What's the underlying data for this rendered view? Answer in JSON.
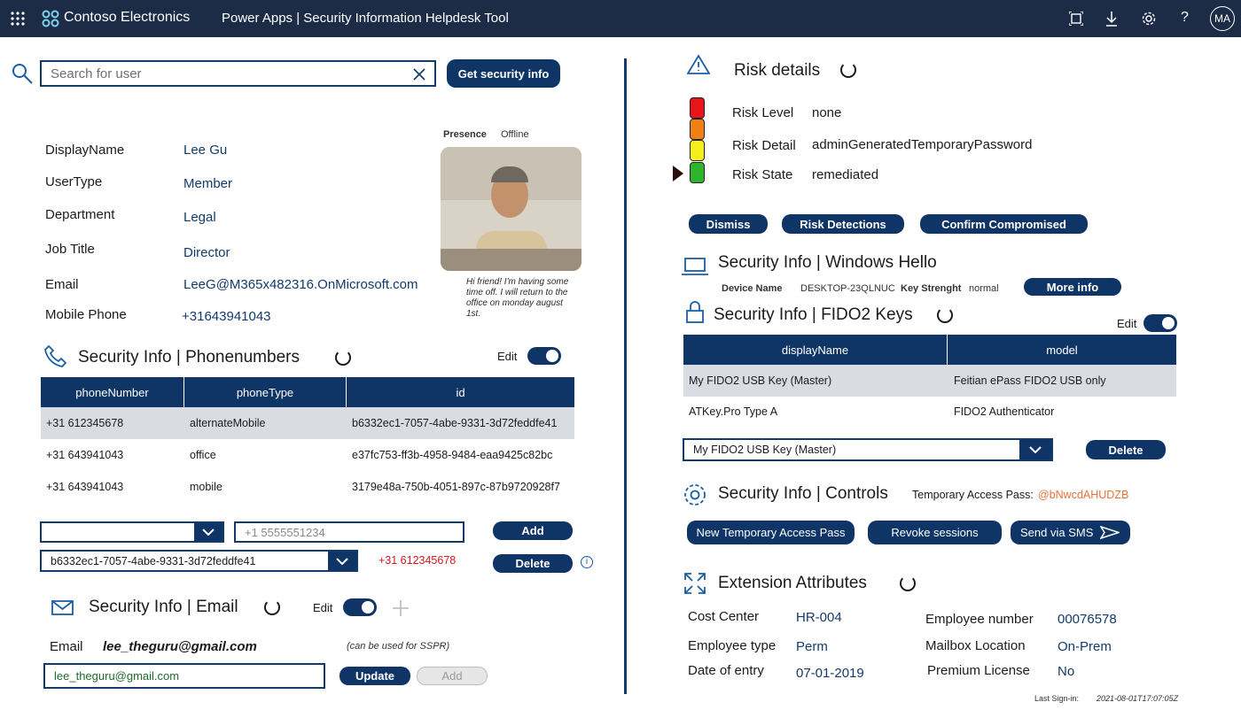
{
  "topbar": {
    "brand": "Contoso Electronics",
    "app": "Power Apps  |  Security Information Helpdesk Tool",
    "avatar": "MA",
    "icons": [
      "waffle-icon",
      "fit-screen-icon",
      "download-icon",
      "settings-icon",
      "help-icon"
    ]
  },
  "search": {
    "placeholder": "Search for user",
    "button": "Get security info"
  },
  "user": {
    "labels": {
      "display": "DisplayName",
      "type": "UserType",
      "dept": "Department",
      "job": "Job Title",
      "email": "Email",
      "phone": "Mobile Phone"
    },
    "values": {
      "display": "Lee Gu",
      "type": "Member",
      "dept": "Legal",
      "job": "Director",
      "email": "LeeG@M365x482316.OnMicrosoft.com",
      "phone": "+31643941043"
    },
    "presence_label": "Presence",
    "presence": "Offline",
    "status_message": "Hi friend! I'm having some time off. I will return to the office on monday august 1st."
  },
  "phones": {
    "title": "Security Info | Phonenumbers",
    "edit": "Edit",
    "columns": [
      "phoneNumber",
      "phoneType",
      "id"
    ],
    "rows": [
      [
        "+31 612345678",
        "alternateMobile",
        "b6332ec1-7057-4abe-9331-3d72feddfe41"
      ],
      [
        "+31 643941043",
        "office",
        "e37fc753-ff3b-4958-9484-eaa9425c82bc"
      ],
      [
        "+31 643941043",
        "mobile",
        "3179e48a-750b-4051-897c-87b9720928f7"
      ]
    ],
    "new_type": "",
    "new_number_placeholder": "+1 5555551234",
    "add": "Add",
    "selected_id": "b6332ec1-7057-4abe-9331-3d72feddfe41",
    "selected_number": "+31 612345678",
    "delete": "Delete"
  },
  "email": {
    "title": "Security Info | Email",
    "edit": "Edit",
    "label": "Email",
    "value": "lee_theguru@gmail.com",
    "note": "(can be used for SSPR)",
    "input": "lee_theguru@gmail.com",
    "update": "Update",
    "add": "Add"
  },
  "risk": {
    "title": "Risk details",
    "labels": {
      "level": "Risk Level",
      "detail": "Risk Detail",
      "state": "Risk State"
    },
    "values": {
      "level": "none",
      "detail": "adminGeneratedTemporaryPassword",
      "state": "remediated"
    },
    "lights": [
      "#e8141a",
      "#f07f15",
      "#f4ee1c",
      "#2fb52b"
    ],
    "buttons": {
      "dismiss": "Dismiss",
      "detections": "Risk Detections",
      "compromised": "Confirm Compromised"
    }
  },
  "hello": {
    "title": "Security Info | Windows Hello",
    "device_label": "Device Name",
    "device": "DESKTOP-23QLNUC",
    "key_label": "Key Strenght",
    "key": "normal",
    "more": "More info"
  },
  "fido": {
    "title": "Security Info | FIDO2 Keys",
    "edit": "Edit",
    "columns": [
      "displayName",
      "model"
    ],
    "rows": [
      [
        "My FIDO2 USB Key (Master)",
        "Feitian ePass FIDO2 USB only"
      ],
      [
        "ATKey.Pro Type A",
        "FIDO2 Authenticator"
      ]
    ],
    "selected": "My FIDO2 USB Key (Master)",
    "delete": "Delete"
  },
  "controls": {
    "title": "Security Info | Controls",
    "tap_label": "Temporary Access Pass:",
    "tap": "@bNwcdAHUDZB",
    "new_tap": "New Temporary Access Pass",
    "revoke": "Revoke sessions",
    "sms": "Send via SMS"
  },
  "ext": {
    "title": "Extension Attributes",
    "labels": {
      "cost": "Cost Center",
      "emptype": "Employee type",
      "date": "Date of entry",
      "empnum": "Employee number",
      "mailbox": "Mailbox Location",
      "premium": "Premium License"
    },
    "values": {
      "cost": "HR-004",
      "emptype": "Perm",
      "date": "07-01-2019",
      "empnum": "00076578",
      "mailbox": "On-Prem",
      "premium": "No"
    }
  },
  "signin": {
    "label": "Last Sign-in:",
    "value": "2021-08-01T17:07:05Z"
  }
}
